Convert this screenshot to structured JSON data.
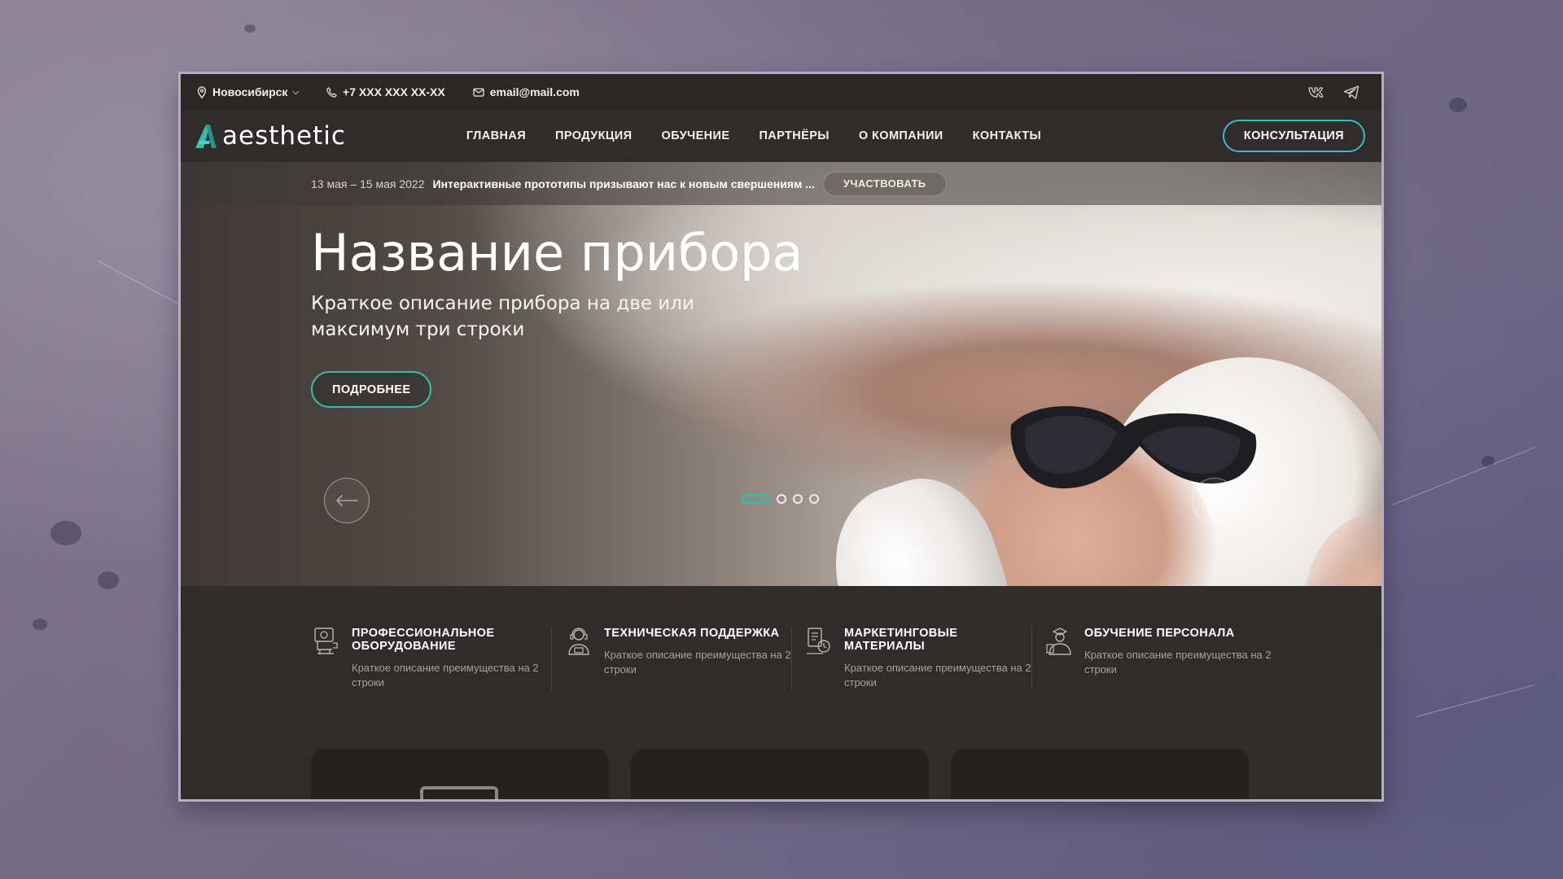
{
  "topbar": {
    "city": "Новосибирск",
    "phone": "+7 XXX XXX XX-XX",
    "email": "email@mail.com",
    "icons": [
      "location-pin-icon",
      "phone-icon",
      "mail-icon",
      "vk-icon",
      "telegram-icon"
    ]
  },
  "nav": {
    "logo_text": "aesthetic",
    "items": [
      "ГЛАВНАЯ",
      "ПРОДУКЦИЯ",
      "ОБУЧЕНИЕ",
      "ПАРТНЁРЫ",
      "О КОМПАНИИ",
      "КОНТАКТЫ"
    ],
    "consult_label": "КОНСУЛЬТАЦИЯ"
  },
  "announcement": {
    "date": "13 мая – 15 мая 2022",
    "text": "Интерактивные прототипы призывают нас к новым свершениям ...",
    "button": "УЧАСТВОВАТЬ"
  },
  "hero": {
    "title": "Название прибора",
    "subtitle": "Краткое описание прибора на две или максимум три строки",
    "button": "ПОДРОБНЕЕ",
    "slides_total": 4,
    "active_slide": 1
  },
  "features": [
    {
      "title": "ПРОФЕССИОНАЛЬНОЕ ОБОРУДОВАНИЕ",
      "desc": "Краткое описание преимущества на 2 строки",
      "icon": "equipment-icon"
    },
    {
      "title": "ТЕХНИЧЕСКАЯ ПОДДЕРЖКА",
      "desc": "Краткое описание преимущества на 2 строки",
      "icon": "support-icon"
    },
    {
      "title": "МАРКЕТИНГОВЫЕ МАТЕРИАЛЫ",
      "desc": "Краткое описание преимущества на 2 строки",
      "icon": "marketing-icon"
    },
    {
      "title": "ОБУЧЕНИЕ ПЕРСОНАЛА",
      "desc": "Краткое описание преимущества на 2 строки",
      "icon": "training-icon"
    }
  ],
  "colors": {
    "accent_teal": "#3eb9a9",
    "accent_cyan": "#3eb9cc",
    "background_dark": "#302c2b"
  }
}
